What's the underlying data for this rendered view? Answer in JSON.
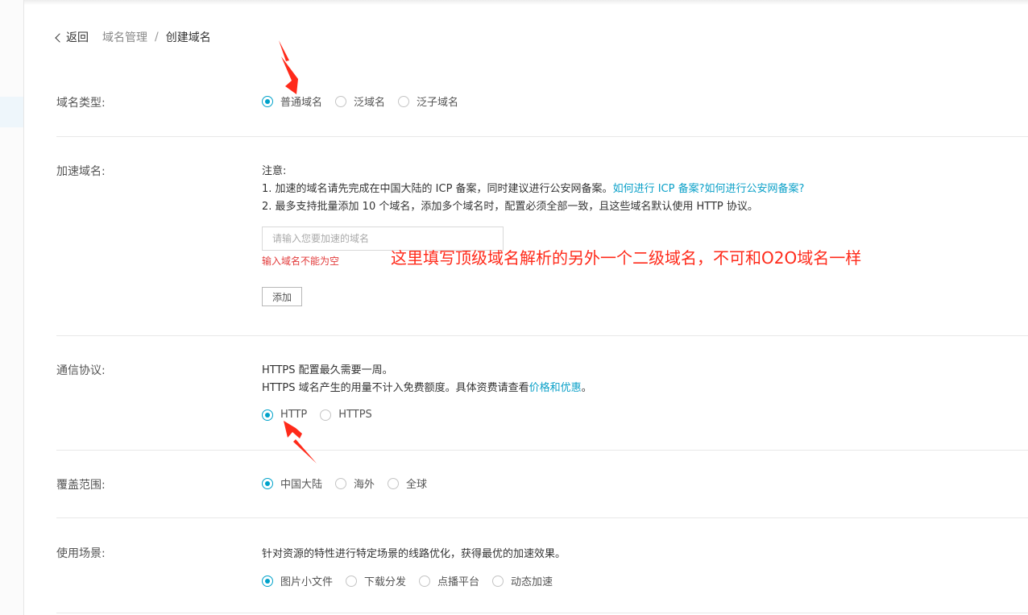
{
  "breadcrumb": {
    "back": "返回",
    "parent": "域名管理",
    "separator": "/",
    "current": "创建域名"
  },
  "domain_type": {
    "label": "域名类型:",
    "options": [
      "普通域名",
      "泛域名",
      "泛子域名"
    ],
    "selected": "普通域名"
  },
  "accel_domain": {
    "label": "加速域名:",
    "note_title": "注意:",
    "note1_text": "1. 加速的域名请先完成在中国大陆的 ICP 备案，同时建议进行公安网备案。",
    "note1_link1": "如何进行 ICP 备案?",
    "note1_link2": "如何进行公安网备案?",
    "note2_text": "2. 最多支持批量添加 10 个域名，添加多个域名时，配置必须全部一致，且这些域名默认使用 HTTP 协议。",
    "input_placeholder": "请输入您要加速的域名",
    "input_value": "",
    "error": "输入域名不能为空",
    "add_button": "添加"
  },
  "annotation": "这里填写顶级域名解析的另外一个二级域名，不可和O2O域名一样",
  "protocol": {
    "label": "通信协议:",
    "line1": "HTTPS 配置最久需要一周。",
    "line2_text": "HTTPS 域名产生的用量不计入免费额度。具体资费请查看",
    "line2_link": "价格和优惠",
    "line2_end": "。",
    "options": [
      "HTTP",
      "HTTPS"
    ],
    "selected": "HTTP"
  },
  "coverage": {
    "label": "覆盖范围:",
    "options": [
      "中国大陆",
      "海外",
      "全球"
    ],
    "selected": "中国大陆"
  },
  "scenario": {
    "label": "使用场景:",
    "desc": "针对资源的特性进行特定场景的线路优化，获得最优的加速效果。",
    "options": [
      "图片小文件",
      "下载分发",
      "点播平台",
      "动态加速"
    ],
    "selected": "图片小文件"
  },
  "colors": {
    "accent": "#00a2ca",
    "link": "#0aa0c8",
    "error": "#e23b3b",
    "annotation": "#ff2a1a"
  }
}
